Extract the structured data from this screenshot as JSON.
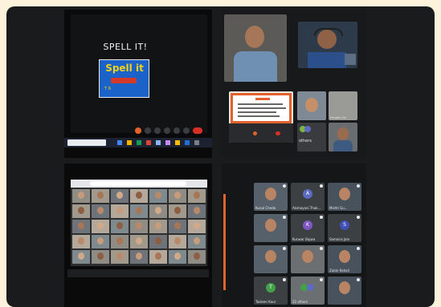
{
  "slide": {
    "title": "SPELL IT!",
    "logo_text": "Spell it",
    "logo_sub": "T  R"
  },
  "meet_grid": {
    "tiles": [
      {
        "name": "Kunal Cheda",
        "avatar": ""
      },
      {
        "name": "Akshayani Thak...",
        "avatar": "A"
      },
      {
        "name": "Mishti Gu...",
        "avatar": ""
      },
      {
        "name": "",
        "avatar": ""
      },
      {
        "name": "Kunwar Bajwa",
        "avatar": "K"
      },
      {
        "name": "Samaira Jain",
        "avatar": "S"
      },
      {
        "name": "",
        "avatar": ""
      },
      {
        "name": "",
        "avatar": ""
      },
      {
        "name": "Zubin Kohali",
        "avatar": ""
      },
      {
        "name": "Tasleen Kaur",
        "avatar": "T"
      },
      {
        "name": "22 others",
        "avatar": ""
      },
      {
        "name": "",
        "avatar": ""
      }
    ]
  },
  "small_grid": {
    "others_label": "others",
    "other_label": "Prerakh Sin"
  },
  "colors": {
    "accent": "#e2612c",
    "screen_blue": "#1f6fd6",
    "logo_bg": "#1b62c9",
    "logo_text": "#f2d21a"
  }
}
